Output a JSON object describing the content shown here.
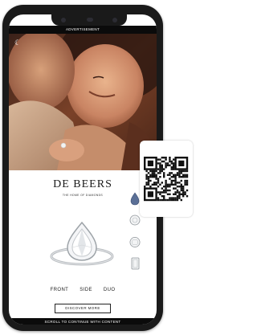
{
  "ad": {
    "top_label": "ADVERTISEMENT",
    "close_icon": "close-icon",
    "brand": "DE BEERS",
    "tagline": "THE HOME OF DIAMONDS",
    "views": [
      "FRONT",
      "SIDE",
      "DUO"
    ],
    "cta": "DISCOVER MORE",
    "bottom_label": "SCROLL TO CONTINUE WITH CONTENT"
  },
  "colors": {
    "phone_frame": "#1a1a1a",
    "bars": "#0b0b0b",
    "hero_warm": "#8a4b30",
    "pear_selected": "#5a6f96"
  },
  "shape_selector": [
    "pear-shape-icon",
    "round-shape-icon",
    "cushion-shape-icon",
    "emerald-shape-icon"
  ],
  "qr_code": "qr-code-icon"
}
